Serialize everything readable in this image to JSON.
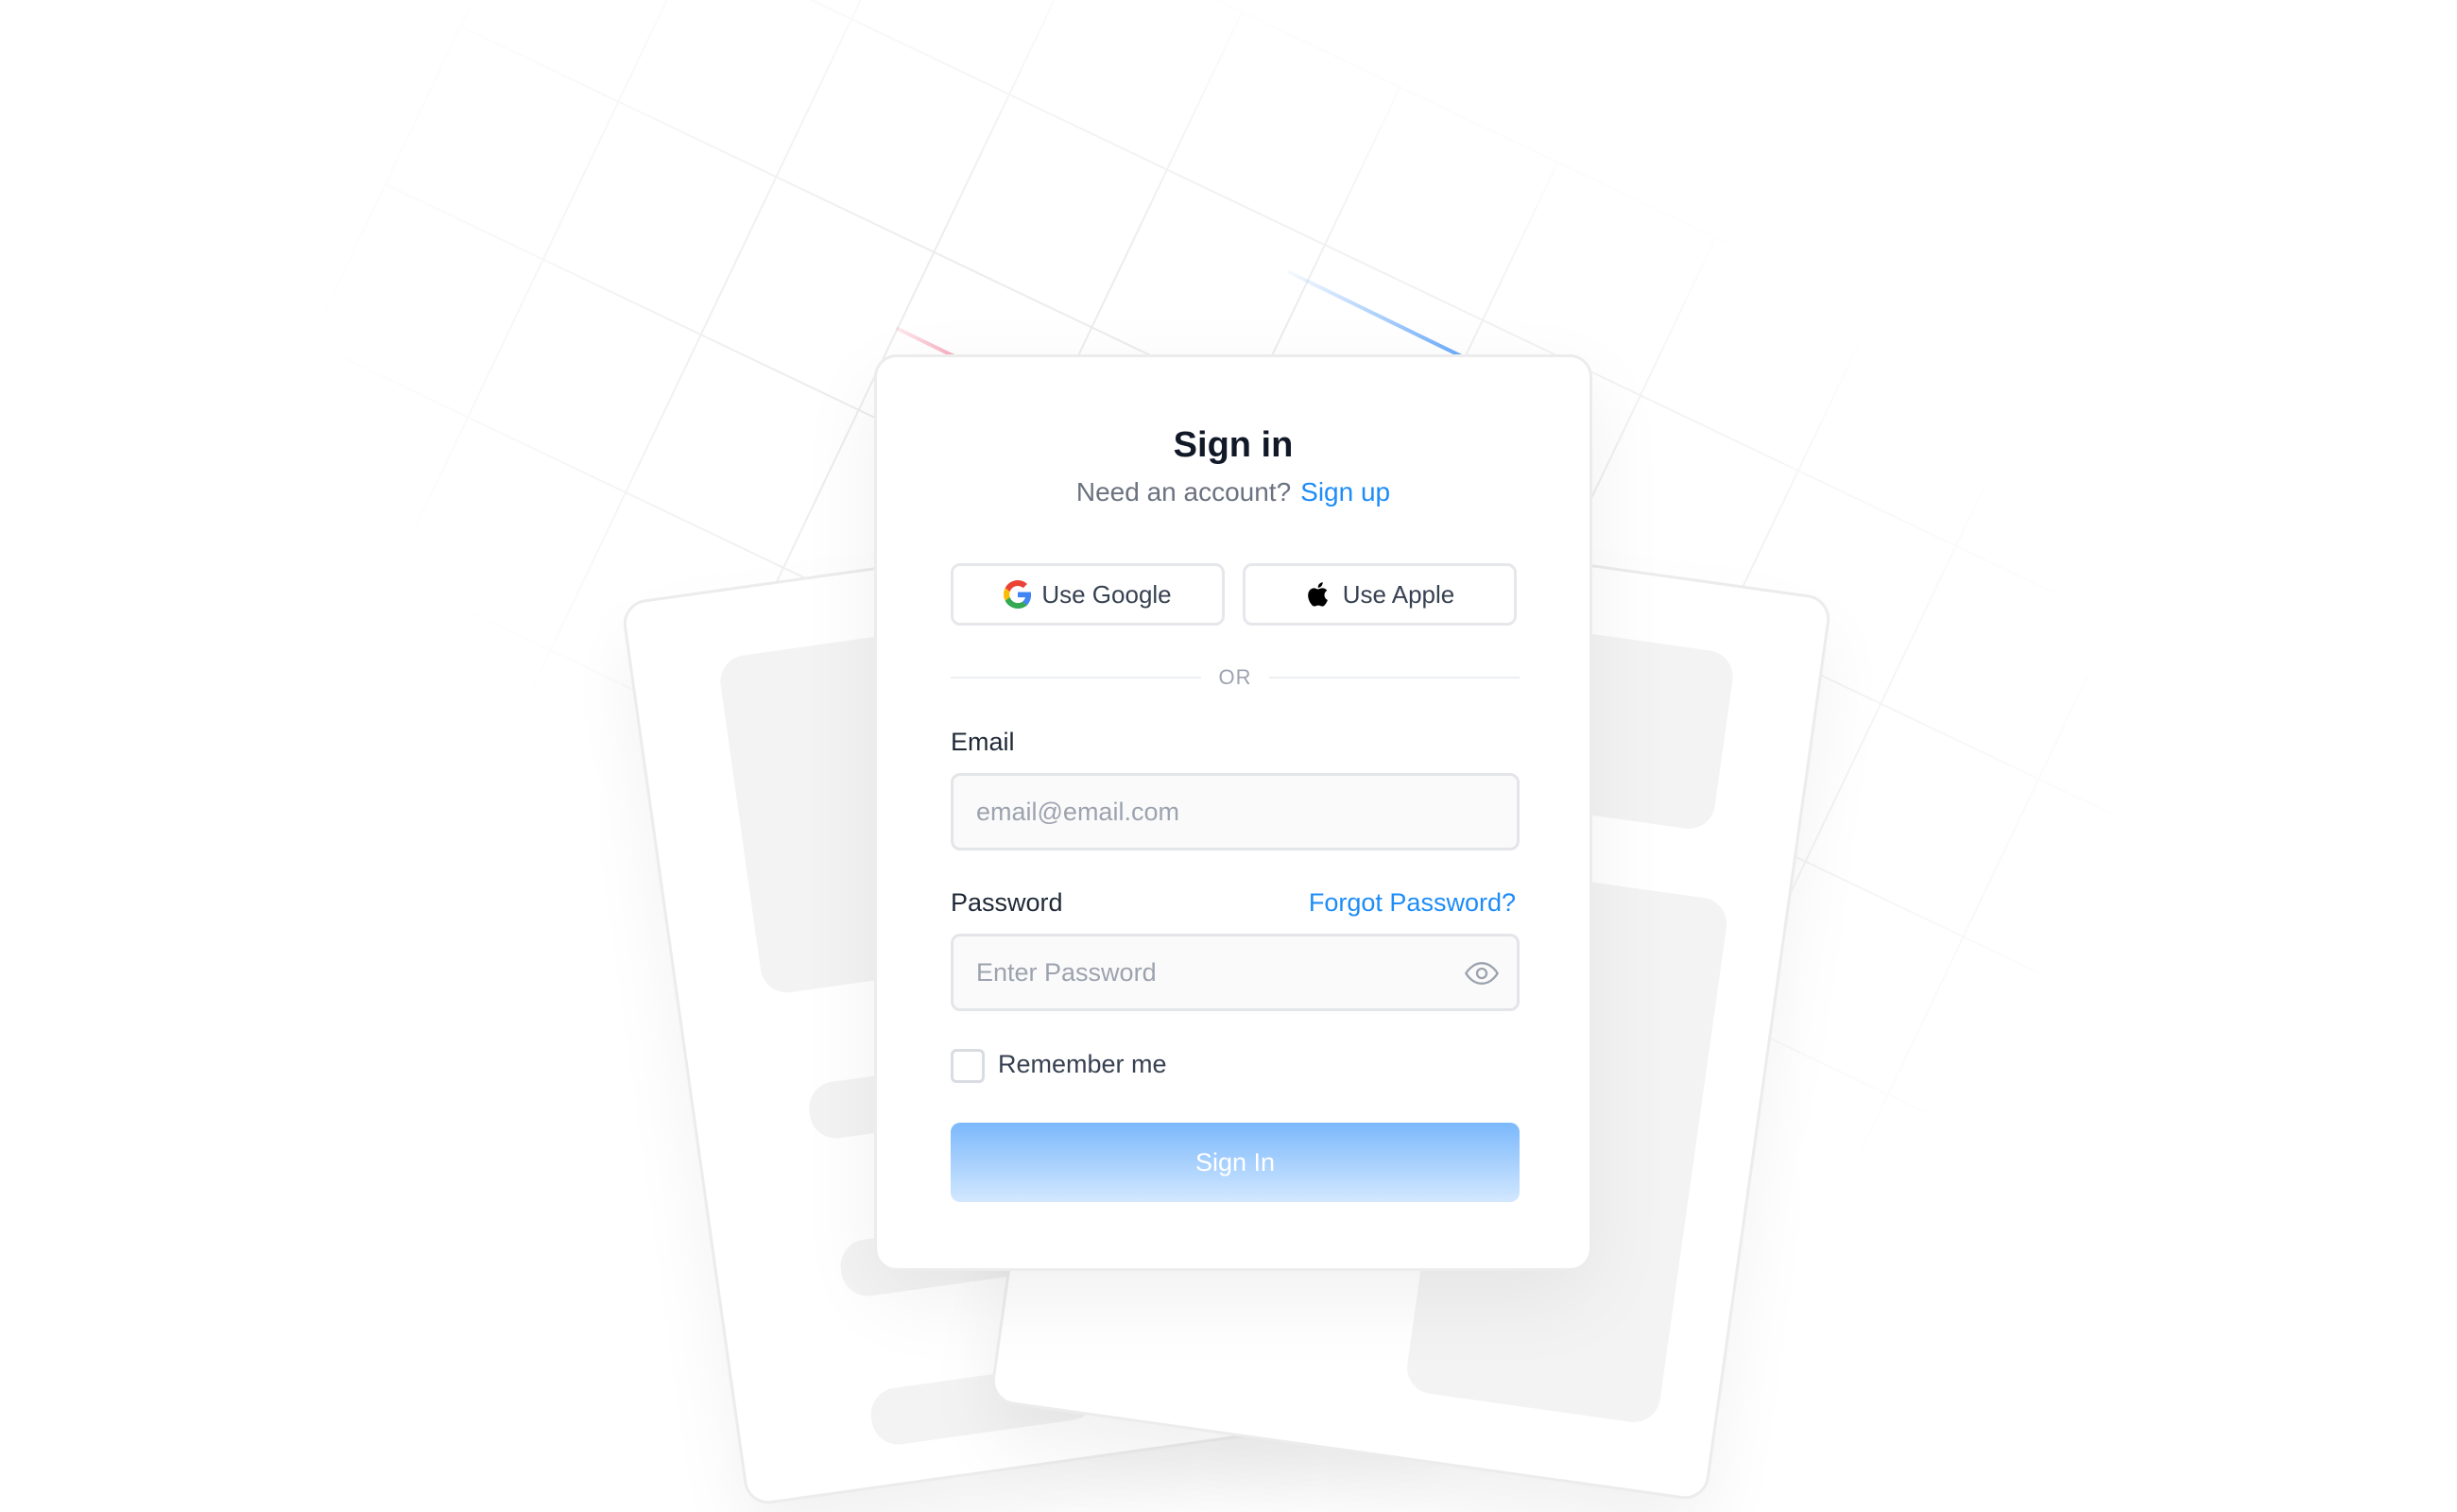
{
  "header": {
    "title": "Sign in",
    "subtitle_prompt": "Need an account?",
    "signup_link": "Sign up"
  },
  "social": {
    "google_label": "Use Google",
    "apple_label": "Use Apple"
  },
  "divider": {
    "text": "OR"
  },
  "email": {
    "label": "Email",
    "placeholder": "email@email.com",
    "value": ""
  },
  "password": {
    "label": "Password",
    "forgot_link": "Forgot Password?",
    "placeholder": "Enter Password",
    "value": ""
  },
  "remember": {
    "label": "Remember me",
    "checked": false
  },
  "submit": {
    "label": "Sign In"
  },
  "icons": {
    "google": "google-icon",
    "apple": "apple-icon",
    "eye": "eye-icon"
  },
  "colors": {
    "accent": "#1d8cf8",
    "button_gradient_top": "#7bb8fb",
    "button_gradient_bottom": "#d3e8ff",
    "title": "#111827"
  }
}
